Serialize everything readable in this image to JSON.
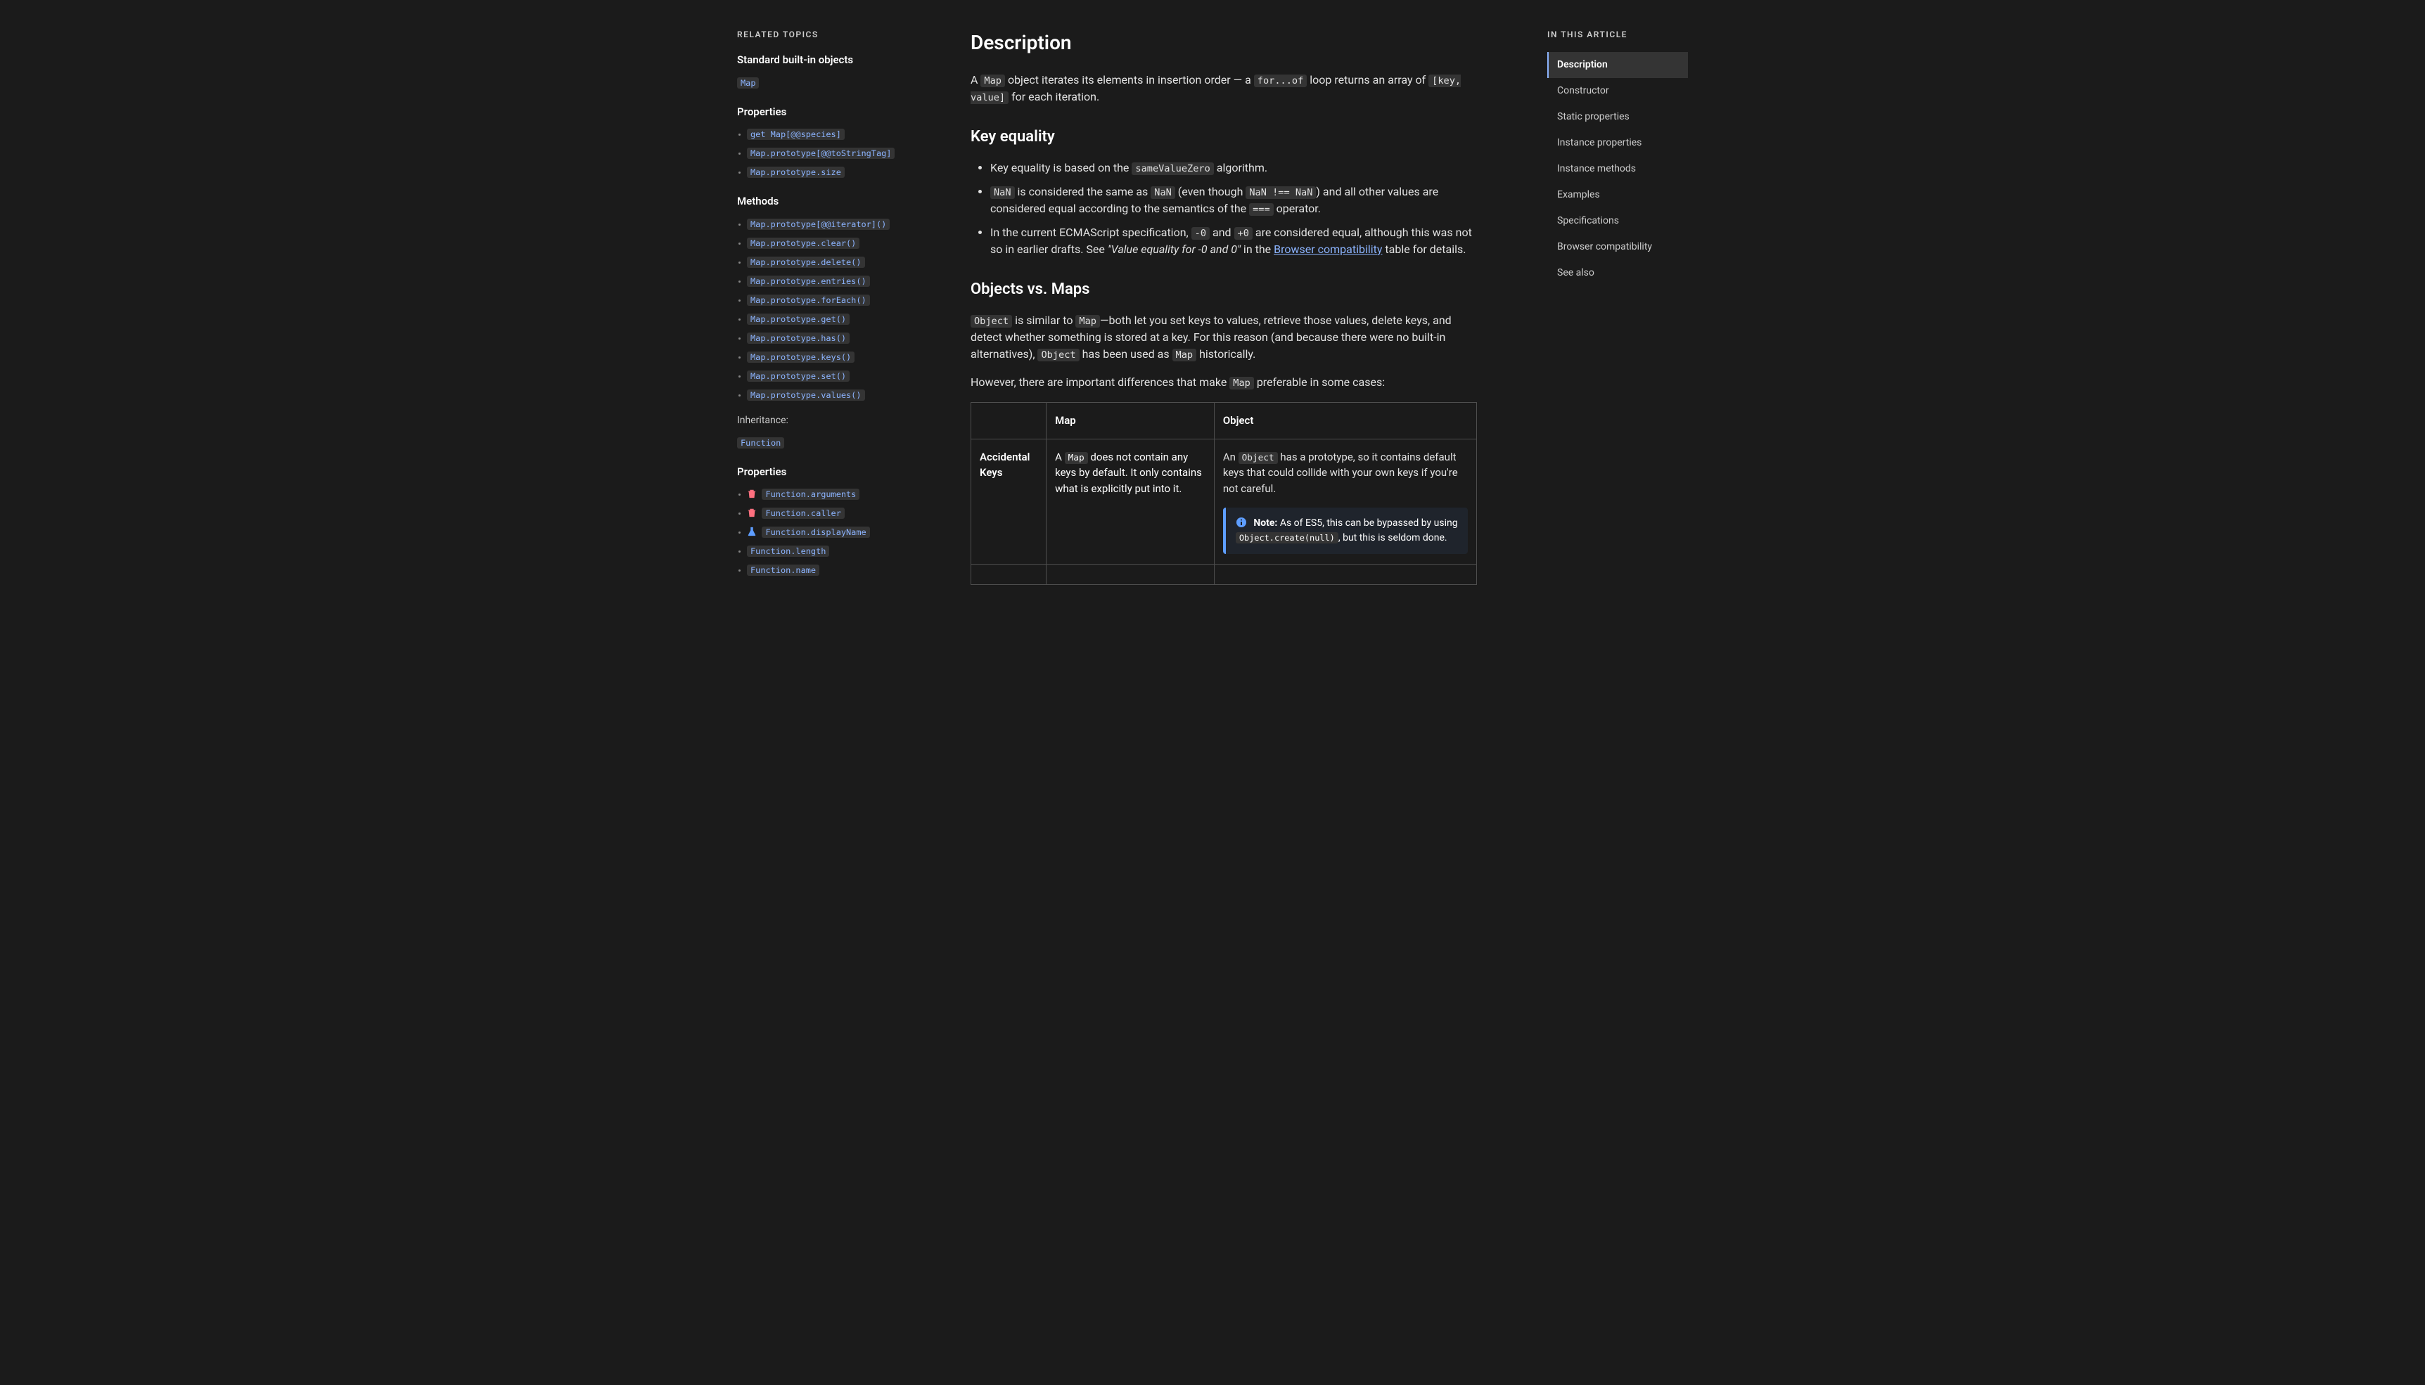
{
  "left": {
    "related_label": "Related Topics",
    "built_in_label": "Standard built-in objects",
    "map_link": "Map",
    "properties_label": "Properties",
    "props": [
      "get Map[@@species]",
      "Map.prototype[@@toStringTag]",
      "Map.prototype.size"
    ],
    "methods_label": "Methods",
    "methods": [
      "Map.prototype[@@iterator]()",
      "Map.prototype.clear()",
      "Map.prototype.delete()",
      "Map.prototype.entries()",
      "Map.prototype.forEach()",
      "Map.prototype.get()",
      "Map.prototype.has()",
      "Map.prototype.keys()",
      "Map.prototype.set()",
      "Map.prototype.values()"
    ],
    "inheritance_label": "Inheritance:",
    "function_link": "Function",
    "func_properties_label": "Properties",
    "func_props": [
      {
        "label": "Function.arguments",
        "deprecated": true
      },
      {
        "label": "Function.caller",
        "deprecated": true
      },
      {
        "label": "Function.displayName",
        "experimental": true
      },
      {
        "label": "Function.length"
      },
      {
        "label": "Function.name"
      }
    ]
  },
  "toc": {
    "label": "In this article",
    "items": [
      {
        "label": "Description",
        "active": true
      },
      {
        "label": "Constructor"
      },
      {
        "label": "Static properties"
      },
      {
        "label": "Instance properties"
      },
      {
        "label": "Instance methods"
      },
      {
        "label": "Examples"
      },
      {
        "label": "Specifications"
      },
      {
        "label": "Browser compatibility"
      },
      {
        "label": "See also"
      }
    ]
  },
  "article": {
    "h2_description": "Description",
    "p1_a": "A ",
    "p1_code1": "Map",
    "p1_b": " object iterates its elements in insertion order — a ",
    "p1_code2": "for...of",
    "p1_c": " loop returns an array of ",
    "p1_code3": "[key, value]",
    "p1_d": " for each iteration.",
    "h3_key_equality": "Key equality",
    "li1_a": "Key equality is based on the ",
    "li1_code": "sameValueZero",
    "li1_b": " algorithm.",
    "li2_code1": "NaN",
    "li2_a": " is considered the same as ",
    "li2_code2": "NaN",
    "li2_b": " (even though ",
    "li2_code3": "NaN !== NaN",
    "li2_c": ") and all other values are considered equal according to the semantics of the ",
    "li2_code4": "===",
    "li2_d": " operator.",
    "li3_a": "In the current ECMAScript specification, ",
    "li3_code1": "-0",
    "li3_b": " and ",
    "li3_code2": "+0",
    "li3_c": " are considered equal, although this was not so in earlier drafts. See ",
    "li3_em": "\"Value equality for -0 and 0\"",
    "li3_d": " in the ",
    "li3_link": "Browser compatibility",
    "li3_e": " table for details.",
    "h3_objects_maps": "Objects vs. Maps",
    "p2_code1": "Object",
    "p2_a": " is similar to ",
    "p2_code2": "Map",
    "p2_b": "—both let you set keys to values, retrieve those values, delete keys, and detect whether something is stored at a key. For this reason (and because there were no built-in alternatives), ",
    "p2_code3": "Object",
    "p2_c": " has been used as ",
    "p2_code4": "Map",
    "p2_d": " historically.",
    "p3_a": "However, there are important differences that make ",
    "p3_code1": "Map",
    "p3_b": " preferable in some cases:",
    "table": {
      "th_map": "Map",
      "th_object": "Object",
      "row1_head": "Accidental Keys",
      "row1_map_a": "A ",
      "row1_map_code": "Map",
      "row1_map_b": " does not contain any keys by default. It only contains what is explicitly put into it.",
      "row1_obj_a": "An ",
      "row1_obj_code": "Object",
      "row1_obj_b": " has a prototype, so it contains default keys that could collide with your own keys if you're not careful.",
      "note_label": "Note:",
      "note_a": " As of ES5, this can be bypassed by using ",
      "note_code": "Object.create(null)",
      "note_b": ", but this is seldom done."
    }
  }
}
